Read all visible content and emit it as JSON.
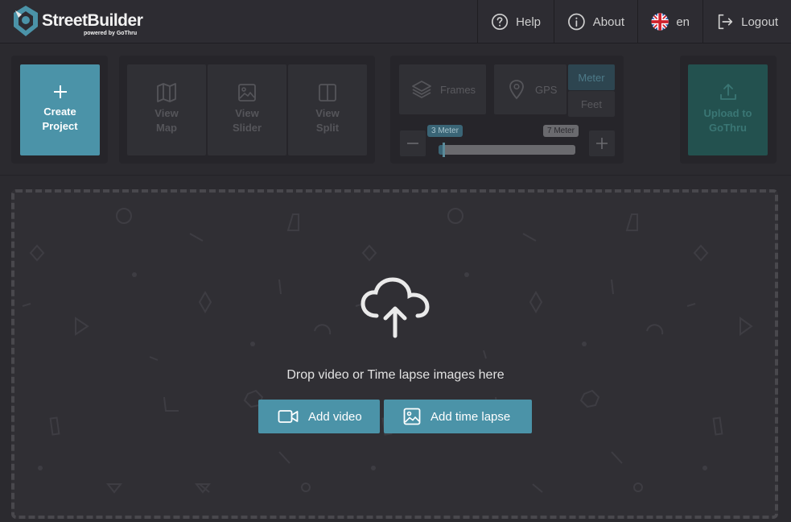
{
  "brand": {
    "name": "StreetBuilder",
    "tagline": "powered by GoThru"
  },
  "nav": {
    "help": "Help",
    "about": "About",
    "language": "en",
    "logout": "Logout"
  },
  "toolbar": {
    "create_line1": "Create",
    "create_line2": "Project",
    "view_map_line1": "View",
    "view_map_line2": "Map",
    "view_slider_line1": "View",
    "view_slider_line2": "Slider",
    "view_split_line1": "View",
    "view_split_line2": "Split",
    "frames": "Frames",
    "gps": "GPS",
    "unit_meter": "Meter",
    "unit_feet": "Feet",
    "slider_min": "3 Meter",
    "slider_max": "7 Meter",
    "upload_line1": "Upload to",
    "upload_line2": "GoThru"
  },
  "dropzone": {
    "prompt": "Drop video or Time lapse images here",
    "add_video": "Add video",
    "add_time_lapse": "Add time lapse"
  },
  "colors": {
    "accent": "#4b93a8",
    "background": "#2b2a2f",
    "upload_disabled": "#23514f"
  }
}
